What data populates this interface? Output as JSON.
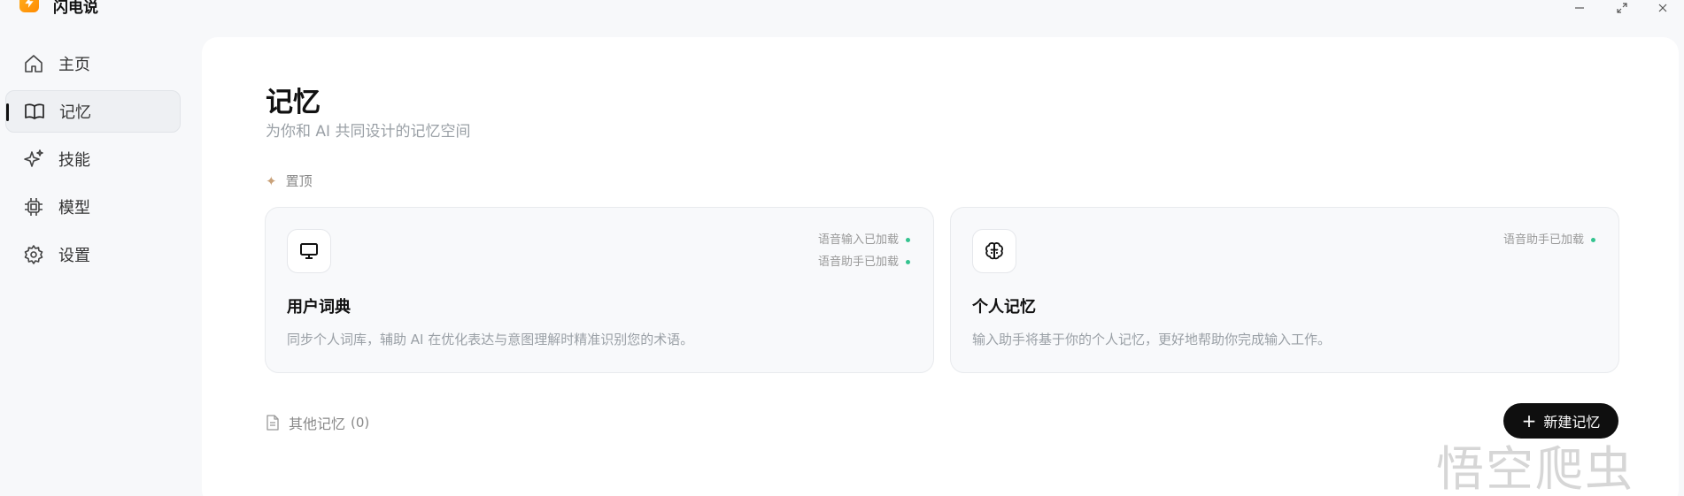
{
  "app": {
    "name": "闪电说"
  },
  "sidebar": {
    "items": [
      {
        "label": "主页",
        "icon": "home-icon"
      },
      {
        "label": "记忆",
        "icon": "book-icon",
        "active": true
      },
      {
        "label": "技能",
        "icon": "sparkles-icon"
      },
      {
        "label": "模型",
        "icon": "chip-icon"
      },
      {
        "label": "设置",
        "icon": "gear-icon"
      }
    ]
  },
  "main": {
    "title": "记忆",
    "subtitle": "为你和 AI 共同设计的记忆空间",
    "pinned_label": "置顶",
    "cards": [
      {
        "title": "用户词典",
        "description": "同步个人词库，辅助 AI 在优化表达与意图理解时精准识别您的术语。",
        "icon": "monitor-icon",
        "statuses": [
          "语音输入已加载",
          "语音助手已加载"
        ]
      },
      {
        "title": "个人记忆",
        "description": "输入助手将基于你的个人记忆，更好地帮助你完成输入工作。",
        "icon": "brain-icon",
        "statuses": [
          "语音助手已加载"
        ]
      }
    ],
    "other_label": "其他记忆",
    "other_count": "(0)",
    "new_button": "新建记忆"
  },
  "watermark": "悟空爬虫",
  "colors": {
    "accent": "#0f0f0f",
    "status_green": "#34c38f",
    "logo": "#ff9a00"
  }
}
